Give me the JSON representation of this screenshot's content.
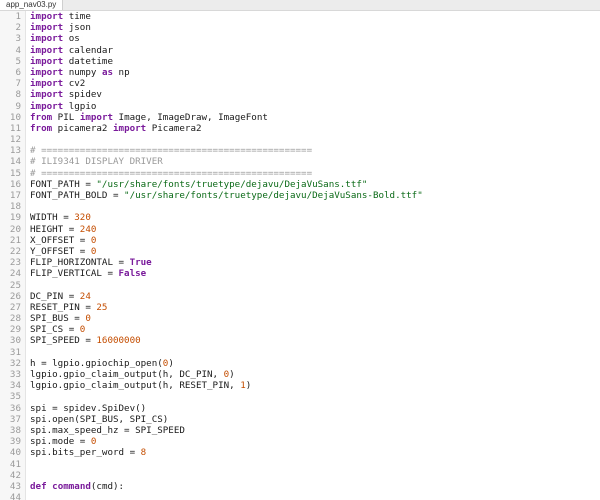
{
  "tab": {
    "filename": "app_nav03.py"
  },
  "editor": {
    "lines": [
      {
        "n": "1",
        "t": [
          [
            "kw",
            "import"
          ],
          [
            "txt",
            " time"
          ]
        ]
      },
      {
        "n": "2",
        "t": [
          [
            "kw",
            "import"
          ],
          [
            "txt",
            " json"
          ]
        ]
      },
      {
        "n": "3",
        "t": [
          [
            "kw",
            "import"
          ],
          [
            "txt",
            " os"
          ]
        ]
      },
      {
        "n": "4",
        "t": [
          [
            "kw",
            "import"
          ],
          [
            "txt",
            " calendar"
          ]
        ]
      },
      {
        "n": "5",
        "t": [
          [
            "kw",
            "import"
          ],
          [
            "txt",
            " datetime"
          ]
        ]
      },
      {
        "n": "6",
        "t": [
          [
            "kw",
            "import"
          ],
          [
            "txt",
            " numpy "
          ],
          [
            "kw",
            "as"
          ],
          [
            "txt",
            " np"
          ]
        ]
      },
      {
        "n": "7",
        "t": [
          [
            "kw",
            "import"
          ],
          [
            "txt",
            " cv2"
          ]
        ]
      },
      {
        "n": "8",
        "t": [
          [
            "kw",
            "import"
          ],
          [
            "txt",
            " spidev"
          ]
        ]
      },
      {
        "n": "9",
        "t": [
          [
            "kw",
            "import"
          ],
          [
            "txt",
            " lgpio"
          ]
        ]
      },
      {
        "n": "10",
        "t": [
          [
            "kw",
            "from"
          ],
          [
            "txt",
            " PIL "
          ],
          [
            "kw",
            "import"
          ],
          [
            "txt",
            " Image, ImageDraw, ImageFont"
          ]
        ]
      },
      {
        "n": "11",
        "t": [
          [
            "kw",
            "from"
          ],
          [
            "txt",
            " picamera2 "
          ],
          [
            "kw",
            "import"
          ],
          [
            "txt",
            " Picamera2"
          ]
        ]
      },
      {
        "n": "12",
        "t": []
      },
      {
        "n": "13",
        "t": [
          [
            "com",
            "# ================================================="
          ]
        ]
      },
      {
        "n": "14",
        "t": [
          [
            "com",
            "# ILI9341 DISPLAY DRIVER"
          ]
        ]
      },
      {
        "n": "15",
        "t": [
          [
            "com",
            "# ================================================="
          ]
        ]
      },
      {
        "n": "16",
        "t": [
          [
            "txt",
            "FONT_PATH = "
          ],
          [
            "str",
            "\"/usr/share/fonts/truetype/dejavu/DejaVuSans.ttf\""
          ]
        ]
      },
      {
        "n": "17",
        "t": [
          [
            "txt",
            "FONT_PATH_BOLD = "
          ],
          [
            "str",
            "\"/usr/share/fonts/truetype/dejavu/DejaVuSans-Bold.ttf\""
          ]
        ]
      },
      {
        "n": "18",
        "t": []
      },
      {
        "n": "19",
        "t": [
          [
            "txt",
            "WIDTH = "
          ],
          [
            "num",
            "320"
          ]
        ]
      },
      {
        "n": "20",
        "t": [
          [
            "txt",
            "HEIGHT = "
          ],
          [
            "num",
            "240"
          ]
        ]
      },
      {
        "n": "21",
        "t": [
          [
            "txt",
            "X_OFFSET = "
          ],
          [
            "num",
            "0"
          ]
        ]
      },
      {
        "n": "22",
        "t": [
          [
            "txt",
            "Y_OFFSET = "
          ],
          [
            "num",
            "0"
          ]
        ]
      },
      {
        "n": "23",
        "t": [
          [
            "txt",
            "FLIP_HORIZONTAL = "
          ],
          [
            "kw",
            "True"
          ]
        ]
      },
      {
        "n": "24",
        "t": [
          [
            "txt",
            "FLIP_VERTICAL = "
          ],
          [
            "kw",
            "False"
          ]
        ]
      },
      {
        "n": "25",
        "t": []
      },
      {
        "n": "26",
        "t": [
          [
            "txt",
            "DC_PIN = "
          ],
          [
            "num",
            "24"
          ]
        ]
      },
      {
        "n": "27",
        "t": [
          [
            "txt",
            "RESET_PIN = "
          ],
          [
            "num",
            "25"
          ]
        ]
      },
      {
        "n": "28",
        "t": [
          [
            "txt",
            "SPI_BUS = "
          ],
          [
            "num",
            "0"
          ]
        ]
      },
      {
        "n": "29",
        "t": [
          [
            "txt",
            "SPI_CS = "
          ],
          [
            "num",
            "0"
          ]
        ]
      },
      {
        "n": "30",
        "t": [
          [
            "txt",
            "SPI_SPEED = "
          ],
          [
            "num",
            "16000000"
          ]
        ]
      },
      {
        "n": "31",
        "t": []
      },
      {
        "n": "32",
        "t": [
          [
            "txt",
            "h = lgpio.gpiochip_open("
          ],
          [
            "num",
            "0"
          ],
          [
            "txt",
            ")"
          ]
        ]
      },
      {
        "n": "33",
        "t": [
          [
            "txt",
            "lgpio.gpio_claim_output(h, DC_PIN, "
          ],
          [
            "num",
            "0"
          ],
          [
            "txt",
            ")"
          ]
        ]
      },
      {
        "n": "34",
        "t": [
          [
            "txt",
            "lgpio.gpio_claim_output(h, RESET_PIN, "
          ],
          [
            "num",
            "1"
          ],
          [
            "txt",
            ")"
          ]
        ]
      },
      {
        "n": "35",
        "t": []
      },
      {
        "n": "36",
        "t": [
          [
            "txt",
            "spi = spidev.SpiDev()"
          ]
        ]
      },
      {
        "n": "37",
        "t": [
          [
            "txt",
            "spi.open(SPI_BUS, SPI_CS)"
          ]
        ]
      },
      {
        "n": "38",
        "t": [
          [
            "txt",
            "spi.max_speed_hz = SPI_SPEED"
          ]
        ]
      },
      {
        "n": "39",
        "t": [
          [
            "txt",
            "spi.mode = "
          ],
          [
            "num",
            "0"
          ]
        ]
      },
      {
        "n": "40",
        "t": [
          [
            "txt",
            "spi.bits_per_word = "
          ],
          [
            "num",
            "8"
          ]
        ]
      },
      {
        "n": "41",
        "t": []
      },
      {
        "n": "42",
        "t": []
      },
      {
        "n": "43",
        "t": [
          [
            "kw",
            "def"
          ],
          [
            "txt",
            " "
          ],
          [
            "kw",
            "command"
          ],
          [
            "txt",
            "(cmd):"
          ]
        ]
      },
      {
        "n": "44",
        "t": []
      }
    ]
  }
}
